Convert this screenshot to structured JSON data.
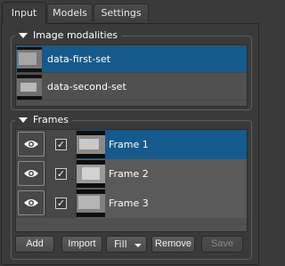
{
  "tabs": [
    {
      "label": "Input",
      "active": true
    },
    {
      "label": "Models",
      "active": false
    },
    {
      "label": "Settings",
      "active": false
    }
  ],
  "image_modalities": {
    "title": "Image modalities",
    "items": [
      {
        "label": "data-first-set",
        "selected": true
      },
      {
        "label": "data-second-set",
        "selected": false
      }
    ]
  },
  "frames": {
    "title": "Frames",
    "items": [
      {
        "label": "Frame 1",
        "visible": true,
        "checked": true,
        "selected": true
      },
      {
        "label": "Frame 2",
        "visible": true,
        "checked": true,
        "selected": false
      },
      {
        "label": "Frame 3",
        "visible": true,
        "checked": true,
        "selected": false
      }
    ]
  },
  "buttons": {
    "add": "Add",
    "import": "Import",
    "fill": "Fill",
    "remove": "Remove",
    "save": "Save"
  },
  "icons": {
    "checkmark": "✓"
  },
  "colors": {
    "selection": "#155a8c",
    "background": "#3a3a3a"
  }
}
